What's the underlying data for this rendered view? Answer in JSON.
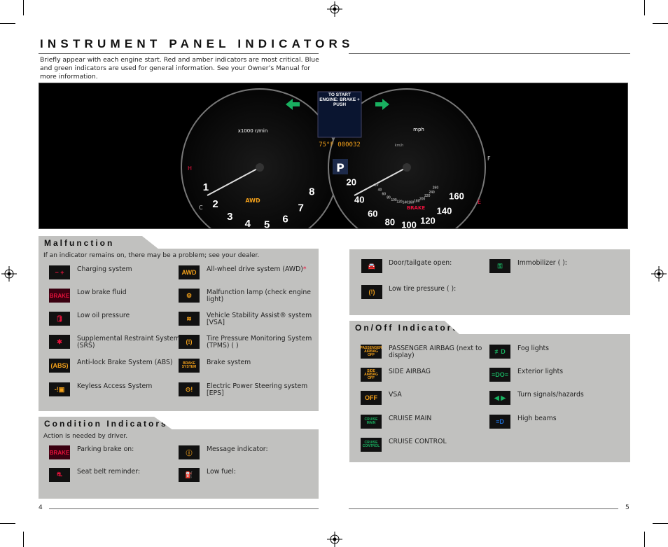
{
  "header": {
    "title": "INSTRUMENT PANEL INDICATORS",
    "intro": "Briefly appear with each engine start. Red and amber indicators are most critical. Blue and green indicators are used for general information. See your Owner’s Manual for more information."
  },
  "dashboard": {
    "tach_numbers": [
      "1",
      "2",
      "3",
      "4",
      "5",
      "6",
      "7",
      "8"
    ],
    "tach_unit": "x1000 r/min",
    "speedo_numbers": [
      "20",
      "40",
      "60",
      "80",
      "100",
      "120",
      "140",
      "160"
    ],
    "speedo_unit": "mph",
    "kmh_numbers": [
      "20",
      "40",
      "60",
      "80",
      "100",
      "120",
      "140",
      "160",
      "180",
      "200",
      "220",
      "240",
      "260"
    ],
    "kmh_unit": "km/h",
    "display_text": "TO START ENGINE: BRAKE + PUSH",
    "odometer": "75°F 000032",
    "gear": "P",
    "awd": "AWD",
    "brake": "BRAKE",
    "temp_h": "H",
    "temp_c": "C",
    "fuel_f": "F",
    "fuel_e": "E"
  },
  "malfunction": {
    "heading": "Malfunction Indicators",
    "note": "If an indicator remains on, there may be a problem; see your dealer.",
    "left": [
      {
        "icon": "battery-icon",
        "glyph": "− +",
        "color": "#e8123c",
        "label": "Charging system"
      },
      {
        "icon": "brake-text-icon",
        "glyph": "BRAKE",
        "color": "#e8123c",
        "label": "Low brake fluid"
      },
      {
        "icon": "oil-can-icon",
        "glyph": "🛢",
        "color": "#e8123c",
        "label": "Low oil pressure"
      },
      {
        "icon": "airbag-icon",
        "glyph": "✱",
        "color": "#e8123c",
        "label": "Supplemental Restraint System (SRS)"
      },
      {
        "icon": "abs-icon",
        "glyph": "(ABS)",
        "color": "#f2a01a",
        "label": "Anti-lock Brake System (ABS)"
      },
      {
        "icon": "keyless-icon",
        "glyph": "-!▣",
        "color": "#f2a01a",
        "label": "Keyless Access System"
      }
    ],
    "right": [
      {
        "icon": "awd-icon",
        "glyph": "AWD",
        "color": "#f2a01a",
        "label": "All-wheel drive system (AWD)",
        "asterisk": "*"
      },
      {
        "icon": "engine-icon",
        "glyph": "⚙",
        "color": "#f2a01a",
        "label": "Malfunction lamp (check engine light)"
      },
      {
        "icon": "vsa-icon",
        "glyph": "≋",
        "color": "#f2a01a",
        "label": "Vehicle Stability Assist® system [VSA]"
      },
      {
        "icon": "tpms-icon",
        "glyph": "(!)",
        "color": "#f2a01a",
        "label": "Tire Pressure Monitoring System (TPMS) (                              )"
      },
      {
        "icon": "brake-system-icon",
        "glyph": "BRAKE SYSTEM",
        "color": "#f2a01a",
        "label": "Brake system"
      },
      {
        "icon": "eps-icon",
        "glyph": "⊙!",
        "color": "#f2a01a",
        "label": "Electric Power Steering system [EPS]"
      }
    ]
  },
  "condition": {
    "heading": "Condition Indicators",
    "note": "Action is needed by driver.",
    "items": [
      {
        "icon": "parking-brake-icon",
        "glyph": "BRAKE",
        "color": "#e8123c",
        "label": "Parking brake on:"
      },
      {
        "icon": "message-icon",
        "glyph": "ⓘ",
        "color": "#f2a01a",
        "label": "Message indicator:"
      },
      {
        "icon": "seat-belt-icon",
        "glyph": "⛐",
        "color": "#e8123c",
        "label": "Seat belt reminder:"
      },
      {
        "icon": "fuel-icon",
        "glyph": "⛽",
        "color": "#f2a01a",
        "label": "Low fuel:"
      }
    ]
  },
  "condition_right": {
    "items": [
      {
        "icon": "door-open-icon",
        "glyph": "🚘",
        "color": "#e8123c",
        "label": "Door/tailgate open:"
      },
      {
        "icon": "immobilizer-key-icon",
        "glyph": "⚿",
        "color": "#19b060",
        "label": "Immobilizer (         ):"
      },
      {
        "icon": "low-tire-icon",
        "glyph": "(!)",
        "color": "#f2a01a",
        "label": "Low tire pressure (              ):"
      }
    ]
  },
  "onoff": {
    "heading": "On/Off Indicators",
    "left": [
      {
        "icon": "passenger-airbag-icon",
        "glyph": "PASSENGER AIRBAG OFF",
        "color": "#f2a01a",
        "label": "PASSENGER AIRBAG (next to display)"
      },
      {
        "icon": "side-airbag-icon",
        "glyph": "SIDE AIRBAG OFF",
        "color": "#f2a01a",
        "label": "SIDE AIRBAG"
      },
      {
        "icon": "vsa-off-icon",
        "glyph": "OFF",
        "color": "#f2a01a",
        "label": "VSA"
      },
      {
        "icon": "cruise-main-icon",
        "glyph": "CRUISE MAIN",
        "color": "#19b060",
        "label": "CRUISE MAIN"
      },
      {
        "icon": "cruise-control-icon",
        "glyph": "CRUISE CONTROL",
        "color": "#19b060",
        "label": "CRUISE CONTROL"
      }
    ],
    "right": [
      {
        "icon": "fog-light-icon",
        "glyph": "≢D",
        "color": "#19b060",
        "label": "Fog lights"
      },
      {
        "icon": "exterior-lights-icon",
        "glyph": "≡DO≡",
        "color": "#19b060",
        "label": "Exterior lights"
      },
      {
        "icon": "turn-signal-icon",
        "glyph": "◀ ▶",
        "color": "#19b060",
        "label": "Turn signals/hazards"
      },
      {
        "icon": "high-beam-icon",
        "glyph": "≡D",
        "color": "#1e6fd8",
        "label": "High beams"
      }
    ]
  },
  "footer": {
    "left_page": "4",
    "right_page": "5"
  }
}
